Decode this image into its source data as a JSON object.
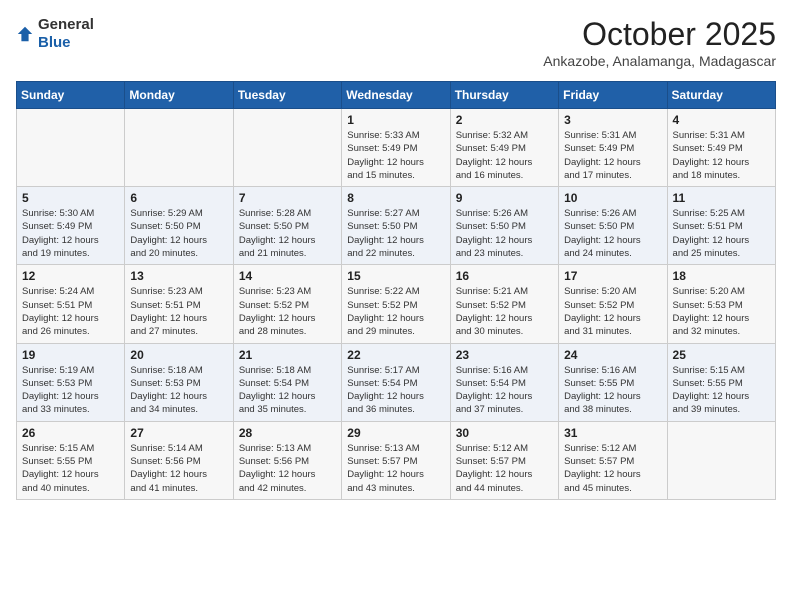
{
  "header": {
    "logo_general": "General",
    "logo_blue": "Blue",
    "month_title": "October 2025",
    "location": "Ankazobe, Analamanga, Madagascar"
  },
  "days_of_week": [
    "Sunday",
    "Monday",
    "Tuesday",
    "Wednesday",
    "Thursday",
    "Friday",
    "Saturday"
  ],
  "weeks": [
    [
      {
        "day": "",
        "info": ""
      },
      {
        "day": "",
        "info": ""
      },
      {
        "day": "",
        "info": ""
      },
      {
        "day": "1",
        "info": "Sunrise: 5:33 AM\nSunset: 5:49 PM\nDaylight: 12 hours\nand 15 minutes."
      },
      {
        "day": "2",
        "info": "Sunrise: 5:32 AM\nSunset: 5:49 PM\nDaylight: 12 hours\nand 16 minutes."
      },
      {
        "day": "3",
        "info": "Sunrise: 5:31 AM\nSunset: 5:49 PM\nDaylight: 12 hours\nand 17 minutes."
      },
      {
        "day": "4",
        "info": "Sunrise: 5:31 AM\nSunset: 5:49 PM\nDaylight: 12 hours\nand 18 minutes."
      }
    ],
    [
      {
        "day": "5",
        "info": "Sunrise: 5:30 AM\nSunset: 5:49 PM\nDaylight: 12 hours\nand 19 minutes."
      },
      {
        "day": "6",
        "info": "Sunrise: 5:29 AM\nSunset: 5:50 PM\nDaylight: 12 hours\nand 20 minutes."
      },
      {
        "day": "7",
        "info": "Sunrise: 5:28 AM\nSunset: 5:50 PM\nDaylight: 12 hours\nand 21 minutes."
      },
      {
        "day": "8",
        "info": "Sunrise: 5:27 AM\nSunset: 5:50 PM\nDaylight: 12 hours\nand 22 minutes."
      },
      {
        "day": "9",
        "info": "Sunrise: 5:26 AM\nSunset: 5:50 PM\nDaylight: 12 hours\nand 23 minutes."
      },
      {
        "day": "10",
        "info": "Sunrise: 5:26 AM\nSunset: 5:50 PM\nDaylight: 12 hours\nand 24 minutes."
      },
      {
        "day": "11",
        "info": "Sunrise: 5:25 AM\nSunset: 5:51 PM\nDaylight: 12 hours\nand 25 minutes."
      }
    ],
    [
      {
        "day": "12",
        "info": "Sunrise: 5:24 AM\nSunset: 5:51 PM\nDaylight: 12 hours\nand 26 minutes."
      },
      {
        "day": "13",
        "info": "Sunrise: 5:23 AM\nSunset: 5:51 PM\nDaylight: 12 hours\nand 27 minutes."
      },
      {
        "day": "14",
        "info": "Sunrise: 5:23 AM\nSunset: 5:52 PM\nDaylight: 12 hours\nand 28 minutes."
      },
      {
        "day": "15",
        "info": "Sunrise: 5:22 AM\nSunset: 5:52 PM\nDaylight: 12 hours\nand 29 minutes."
      },
      {
        "day": "16",
        "info": "Sunrise: 5:21 AM\nSunset: 5:52 PM\nDaylight: 12 hours\nand 30 minutes."
      },
      {
        "day": "17",
        "info": "Sunrise: 5:20 AM\nSunset: 5:52 PM\nDaylight: 12 hours\nand 31 minutes."
      },
      {
        "day": "18",
        "info": "Sunrise: 5:20 AM\nSunset: 5:53 PM\nDaylight: 12 hours\nand 32 minutes."
      }
    ],
    [
      {
        "day": "19",
        "info": "Sunrise: 5:19 AM\nSunset: 5:53 PM\nDaylight: 12 hours\nand 33 minutes."
      },
      {
        "day": "20",
        "info": "Sunrise: 5:18 AM\nSunset: 5:53 PM\nDaylight: 12 hours\nand 34 minutes."
      },
      {
        "day": "21",
        "info": "Sunrise: 5:18 AM\nSunset: 5:54 PM\nDaylight: 12 hours\nand 35 minutes."
      },
      {
        "day": "22",
        "info": "Sunrise: 5:17 AM\nSunset: 5:54 PM\nDaylight: 12 hours\nand 36 minutes."
      },
      {
        "day": "23",
        "info": "Sunrise: 5:16 AM\nSunset: 5:54 PM\nDaylight: 12 hours\nand 37 minutes."
      },
      {
        "day": "24",
        "info": "Sunrise: 5:16 AM\nSunset: 5:55 PM\nDaylight: 12 hours\nand 38 minutes."
      },
      {
        "day": "25",
        "info": "Sunrise: 5:15 AM\nSunset: 5:55 PM\nDaylight: 12 hours\nand 39 minutes."
      }
    ],
    [
      {
        "day": "26",
        "info": "Sunrise: 5:15 AM\nSunset: 5:55 PM\nDaylight: 12 hours\nand 40 minutes."
      },
      {
        "day": "27",
        "info": "Sunrise: 5:14 AM\nSunset: 5:56 PM\nDaylight: 12 hours\nand 41 minutes."
      },
      {
        "day": "28",
        "info": "Sunrise: 5:13 AM\nSunset: 5:56 PM\nDaylight: 12 hours\nand 42 minutes."
      },
      {
        "day": "29",
        "info": "Sunrise: 5:13 AM\nSunset: 5:57 PM\nDaylight: 12 hours\nand 43 minutes."
      },
      {
        "day": "30",
        "info": "Sunrise: 5:12 AM\nSunset: 5:57 PM\nDaylight: 12 hours\nand 44 minutes."
      },
      {
        "day": "31",
        "info": "Sunrise: 5:12 AM\nSunset: 5:57 PM\nDaylight: 12 hours\nand 45 minutes."
      },
      {
        "day": "",
        "info": ""
      }
    ]
  ]
}
